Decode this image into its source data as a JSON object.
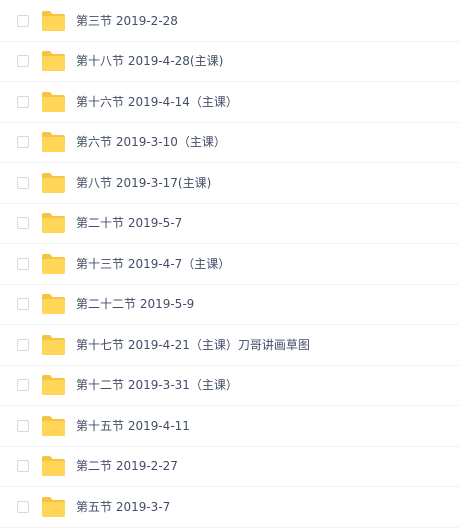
{
  "files": [
    {
      "name": "第三节 2019-2-28"
    },
    {
      "name": "第十八节 2019-4-28(主课)"
    },
    {
      "name": "第十六节 2019-4-14（主课）"
    },
    {
      "name": "第六节 2019-3-10（主课）"
    },
    {
      "name": "第八节 2019-3-17(主课)"
    },
    {
      "name": "第二十节 2019-5-7"
    },
    {
      "name": "第十三节 2019-4-7（主课）"
    },
    {
      "name": "第二十二节 2019-5-9"
    },
    {
      "name": "第十七节 2019-4-21（主课）刀哥讲画草图"
    },
    {
      "name": "第十二节 2019-3-31（主课）"
    },
    {
      "name": "第十五节 2019-4-11"
    },
    {
      "name": "第二节 2019-2-27"
    },
    {
      "name": "第五节 2019-3-7"
    }
  ],
  "icons": {
    "row_icon": "folder-icon",
    "folder_color": "#ffd658",
    "folder_tab_color": "#f5c443"
  }
}
